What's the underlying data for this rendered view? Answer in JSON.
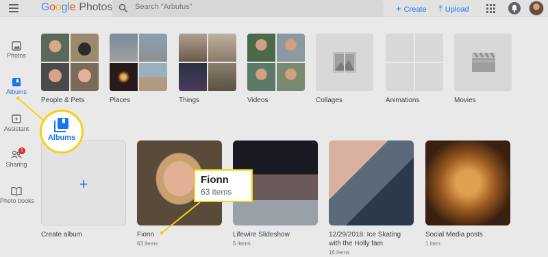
{
  "header": {
    "logo_google": [
      "G",
      "o",
      "o",
      "g",
      "l",
      "e"
    ],
    "logo_photos": "Photos",
    "search_placeholder": "Search \"Arbutus\"",
    "create_label": "Create",
    "upload_label": "Upload"
  },
  "sidebar": {
    "items": [
      {
        "label": "Photos"
      },
      {
        "label": "Albums"
      },
      {
        "label": "Assistant"
      },
      {
        "label": "Sharing",
        "badge": "1"
      },
      {
        "label": "Photo books"
      }
    ]
  },
  "categories": [
    {
      "label": "People & Pets"
    },
    {
      "label": "Places"
    },
    {
      "label": "Things"
    },
    {
      "label": "Videos"
    },
    {
      "label": "Collages"
    },
    {
      "label": "Animations"
    },
    {
      "label": "Movies"
    }
  ],
  "albums": [
    {
      "name": "Create album",
      "count": ""
    },
    {
      "name": "Fionn",
      "count": "63 items"
    },
    {
      "name": "Lifewire Slideshow",
      "count": "5 items"
    },
    {
      "name": "12/29/2018: Ice Skating with the Holly fam",
      "name_line1": "12/29/2018: Ice Skating",
      "name_line2": "with the Holly fam",
      "count": "16 items"
    },
    {
      "name": "Social Media posts",
      "count": "1 item"
    }
  ],
  "callouts": {
    "albums_label": "Albums",
    "fionn_title": "Fionn",
    "fionn_count": "63 items"
  },
  "colors": {
    "accent": "#1a73e8",
    "highlight": "#f4d20f",
    "badge": "#d93025"
  }
}
